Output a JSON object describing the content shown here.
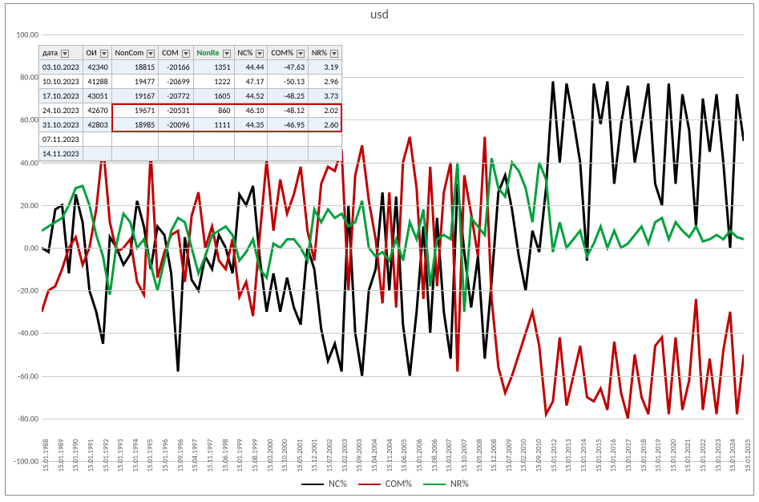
{
  "title": "usd",
  "table": {
    "headers": [
      "дата",
      "ОИ",
      "NonCom",
      "COM",
      "NonRe",
      "NC%",
      "COM%",
      "NR%"
    ],
    "highlight_col": 4,
    "rows": [
      {
        "date": "03.10.2023",
        "oi": "42340",
        "noncom": "18815",
        "com": "-20166",
        "nonre": "1351",
        "nc": "44.44",
        "comp": "-47.63",
        "nr": "3.19"
      },
      {
        "date": "10.10.2023",
        "oi": "41288",
        "noncom": "19477",
        "com": "-20699",
        "nonre": "1222",
        "nc": "47.17",
        "comp": "-50.13",
        "nr": "2.96"
      },
      {
        "date": "17.10.2023",
        "oi": "43051",
        "noncom": "19167",
        "com": "-20772",
        "nonre": "1605",
        "nc": "44.52",
        "comp": "-48.25",
        "nr": "3.73"
      },
      {
        "date": "24.10.2023",
        "oi": "42670",
        "noncom": "19671",
        "com": "-20531",
        "nonre": "860",
        "nc": "46.10",
        "comp": "-48.12",
        "nr": "2.02"
      },
      {
        "date": "31.10.2023",
        "oi": "42803",
        "noncom": "18985",
        "com": "-20096",
        "nonre": "1111",
        "nc": "44.35",
        "comp": "-46.95",
        "nr": "2.60"
      },
      {
        "date": "07.11.2023",
        "oi": "",
        "noncom": "",
        "com": "",
        "nonre": "",
        "nc": "",
        "comp": "",
        "nr": ""
      },
      {
        "date": "14.11.2023",
        "oi": "",
        "noncom": "",
        "com": "",
        "nonre": "",
        "nc": "",
        "comp": "",
        "nr": ""
      }
    ],
    "red_box_rows": [
      3,
      4
    ],
    "red_box_cols": [
      2,
      7
    ]
  },
  "legend": [
    {
      "label": "NC%",
      "color": "#000000"
    },
    {
      "label": "COM%",
      "color": "#c00000"
    },
    {
      "label": "NR%",
      "color": "#00a03c"
    }
  ],
  "chart_data": {
    "type": "line",
    "title": "usd",
    "xlabel": "",
    "ylabel": "",
    "ylim": [
      -100,
      100
    ],
    "y_ticks": [
      -100,
      -80,
      -60,
      -40,
      -20,
      0,
      20,
      40,
      60,
      80,
      100
    ],
    "x_ticks": [
      "15.01.1988",
      "15.01.1989",
      "15.01.1990",
      "15.01.1991",
      "15.01.1992",
      "15.01.1993",
      "15.01.1994",
      "15.01.1995",
      "15.01.1996",
      "15.09.1996",
      "15.04.1997",
      "15.11.1997",
      "15.06.1998",
      "15.01.1999",
      "15.08.1999",
      "15.03.2000",
      "15.10.2000",
      "15.05.2001",
      "15.12.2001",
      "15.07.2002",
      "15.02.2003",
      "15.09.2003",
      "15.04.2004",
      "15.11.2004",
      "15.06.2005",
      "15.01.2006",
      "15.08.2006",
      "15.03.2007",
      "15.10.2007",
      "15.05.2008",
      "15.12.2008",
      "15.07.2009",
      "15.02.2010",
      "15.09.2010",
      "15.01.2012",
      "15.01.2013",
      "15.01.2014",
      "15.01.2015",
      "15.01.2016",
      "15.01.2017",
      "15.01.2018",
      "15.01.2019",
      "15.01.2020",
      "15.01.2021",
      "15.01.2022",
      "15.01.2023",
      "15.01.2024",
      "15.01.2025"
    ],
    "series": [
      {
        "name": "NC%",
        "color": "#000000",
        "y": [
          0,
          -2,
          18,
          20,
          -12,
          25,
          12,
          -20,
          -30,
          -45,
          5,
          0,
          -8,
          -3,
          22,
          10,
          -10,
          10,
          6,
          -12,
          -58,
          5,
          -15,
          -20,
          -4,
          -10,
          6,
          0,
          -12,
          25,
          20,
          29,
          -5,
          -30,
          -12,
          -30,
          -14,
          -28,
          -36,
          0,
          -10,
          -38,
          -53,
          -45,
          -58,
          20,
          -40,
          -60,
          -20,
          -10,
          26,
          -20,
          24,
          -36,
          -60,
          -30,
          10,
          -40,
          14,
          -30,
          -52,
          30,
          -2,
          -28,
          -4,
          -52,
          -16,
          26,
          34,
          18,
          -4,
          -20,
          8,
          -2,
          28,
          78,
          40,
          77,
          60,
          40,
          -6,
          77,
          58,
          78,
          30,
          58,
          76,
          40,
          58,
          77,
          30,
          20,
          77,
          30,
          72,
          55,
          10,
          70,
          45,
          72,
          40,
          0,
          72,
          50
        ]
      },
      {
        "name": "COM%",
        "color": "#c00000",
        "y": [
          -30,
          -20,
          -18,
          -10,
          0,
          5,
          -8,
          0,
          18,
          48,
          12,
          -2,
          0,
          4,
          -16,
          -22,
          45,
          -14,
          -2,
          6,
          8,
          -16,
          15,
          26,
          0,
          10,
          -6,
          -10,
          4,
          -23,
          -16,
          -32,
          6,
          41,
          8,
          32,
          16,
          25,
          38,
          8,
          -6,
          30,
          38,
          36,
          46,
          -20,
          34,
          48,
          22,
          4,
          -26,
          26,
          -28,
          40,
          52,
          28,
          -24,
          38,
          -18,
          26,
          40,
          -58,
          34,
          16,
          -4,
          52,
          -24,
          -56,
          -68,
          -60,
          -50,
          -40,
          -30,
          -46,
          -78,
          -72,
          -42,
          -74,
          -60,
          -46,
          -70,
          -72,
          -66,
          -76,
          -44,
          -68,
          -80,
          -50,
          -70,
          -78,
          -46,
          -42,
          -78,
          -42,
          -76,
          -62,
          -24,
          -76,
          -52,
          -78,
          -48,
          -30,
          -78,
          -50
        ]
      },
      {
        "name": "NR%",
        "color": "#00a03c",
        "y": [
          8,
          10,
          12,
          14,
          20,
          28,
          29,
          20,
          6,
          -4,
          -22,
          2,
          16,
          12,
          0,
          4,
          -8,
          -20,
          -6,
          8,
          14,
          12,
          0,
          -12,
          -4,
          6,
          8,
          10,
          6,
          -6,
          -2,
          4,
          -10,
          -14,
          2,
          0,
          4,
          4,
          0,
          -6,
          18,
          12,
          18,
          14,
          16,
          10,
          12,
          22,
          0,
          -4,
          -2,
          -6,
          4,
          -6,
          12,
          4,
          18,
          -18,
          4,
          6,
          4,
          40,
          -30,
          14,
          10,
          6,
          42,
          28,
          24,
          40,
          36,
          28,
          12,
          40,
          32,
          -2,
          12,
          0,
          4,
          8,
          -4,
          2,
          10,
          0,
          8,
          0,
          2,
          6,
          10,
          2,
          12,
          14,
          4,
          12,
          8,
          5,
          10,
          3,
          4,
          6,
          4,
          8,
          5,
          4
        ]
      }
    ]
  }
}
